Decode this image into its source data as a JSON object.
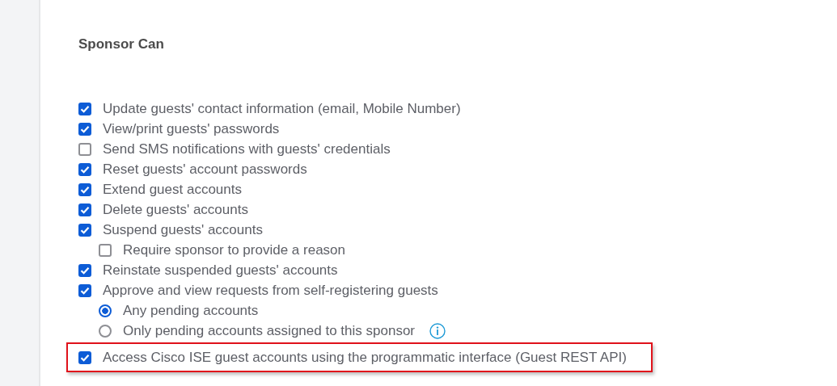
{
  "heading": "Sponsor Can",
  "items": [
    {
      "kind": "checkbox",
      "label": "Update guests' contact information (email, Mobile Number)",
      "checked": true
    },
    {
      "kind": "checkbox",
      "label": "View/print guests' passwords",
      "checked": true
    },
    {
      "kind": "checkbox",
      "label": "Send SMS notifications with guests' credentials",
      "checked": false
    },
    {
      "kind": "checkbox",
      "label": "Reset guests' account passwords",
      "checked": true
    },
    {
      "kind": "checkbox",
      "label": "Extend guest accounts",
      "checked": true
    },
    {
      "kind": "checkbox",
      "label": "Delete guests' accounts",
      "checked": true
    },
    {
      "kind": "checkbox",
      "label": "Suspend guests' accounts",
      "checked": true,
      "children": [
        {
          "kind": "checkbox",
          "label": "Require sponsor to provide a reason",
          "checked": false
        }
      ]
    },
    {
      "kind": "checkbox",
      "label": "Reinstate suspended guests' accounts",
      "checked": true
    },
    {
      "kind": "checkbox",
      "label": "Approve and view requests from self-registering guests",
      "checked": true,
      "children": [
        {
          "kind": "radio",
          "label": "Any pending accounts",
          "selected": true
        },
        {
          "kind": "radio",
          "label": "Only pending accounts assigned to this sponsor",
          "selected": false,
          "info": true
        }
      ]
    },
    {
      "kind": "checkbox",
      "label": "Access Cisco ISE guest accounts using the programmatic interface (Guest REST API)",
      "checked": true,
      "highlighted": true
    }
  ]
}
